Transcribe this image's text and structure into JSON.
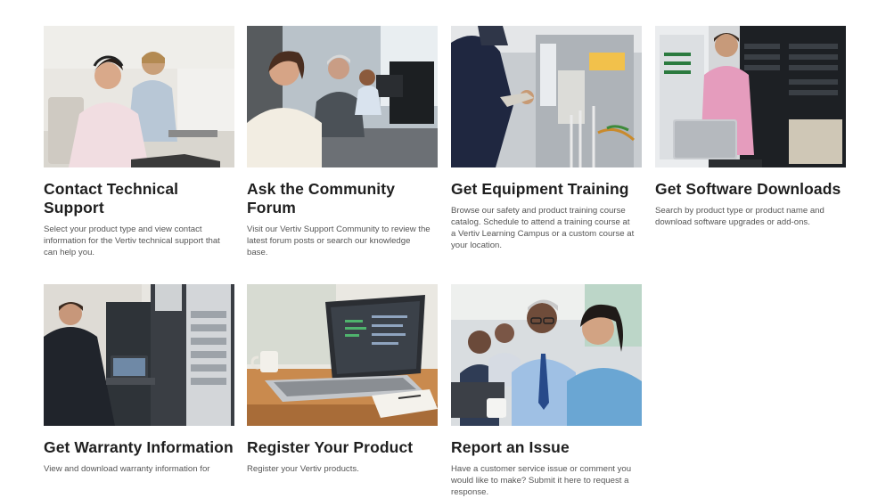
{
  "cards": [
    {
      "title": "Contact Technical Support",
      "description": "Select your product type and view contact information for the Vertiv technical support that can help you.",
      "image": "support-agents-headset-photo"
    },
    {
      "title": "Ask the Community Forum",
      "description": "Visit our Vertiv Support Community to review the latest forum posts or search our knowledge base.",
      "image": "office-workers-photo"
    },
    {
      "title": "Get Equipment Training",
      "description": "Browse our safety and product training course catalog. Schedule to attend a training course at a Vertiv Learning Campus or a custom course at your location.",
      "image": "technician-wiring-panel-photo"
    },
    {
      "title": "Get Software Downloads",
      "description": "Search by product type or product name and download software upgrades or add-ons.",
      "image": "engineer-laptop-server-rack-photo"
    },
    {
      "title": "Get Warranty Information",
      "description": "View and download warranty information for",
      "image": "technician-datacenter-laptop-photo"
    },
    {
      "title": "Register Your Product",
      "description": "Register your Vertiv products.",
      "image": "laptop-on-desk-photo"
    },
    {
      "title": "Report an Issue",
      "description": "Have a customer service issue or comment you would like to make? Submit it here to request a response.",
      "image": "team-at-laptop-photo"
    }
  ]
}
